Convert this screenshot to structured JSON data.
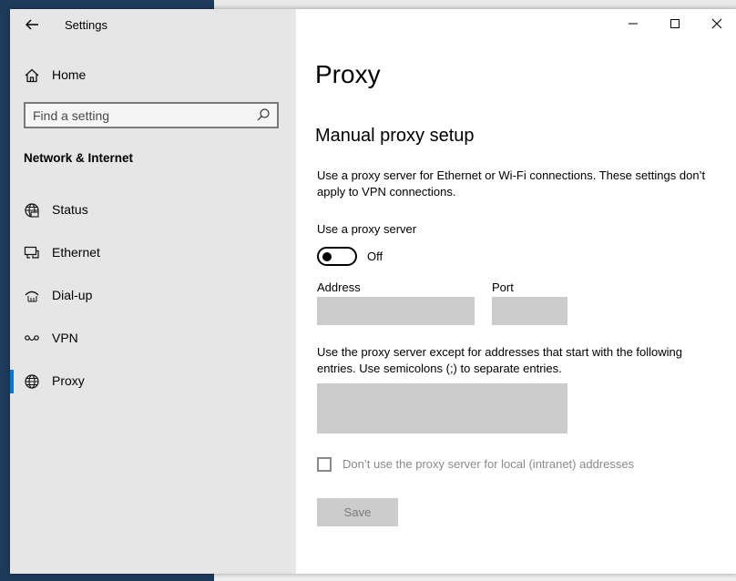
{
  "window": {
    "title": "Settings"
  },
  "sidebar": {
    "home_label": "Home",
    "search_placeholder": "Find a setting",
    "section_heading": "Network & Internet",
    "items": [
      {
        "label": "Status",
        "icon": "globe-status-icon",
        "selected": false
      },
      {
        "label": "Ethernet",
        "icon": "ethernet-icon",
        "selected": false
      },
      {
        "label": "Dial-up",
        "icon": "dial-up-icon",
        "selected": false
      },
      {
        "label": "VPN",
        "icon": "vpn-icon",
        "selected": false
      },
      {
        "label": "Proxy",
        "icon": "globe-icon",
        "selected": true
      }
    ]
  },
  "content": {
    "page_title": "Proxy",
    "section_title": "Manual proxy setup",
    "description": "Use a proxy server for Ethernet or Wi-Fi connections. These settings don’t apply to VPN connections.",
    "use_proxy_label": "Use a proxy server",
    "toggle_state": "Off",
    "address_label": "Address",
    "address_value": "",
    "port_label": "Port",
    "port_value": "",
    "exceptions_description": "Use the proxy server except for addresses that start with the following entries. Use semicolons (;) to separate entries.",
    "exceptions_value": "",
    "local_checkbox_label": "Don’t use the proxy server for local (intranet) addresses",
    "local_checkbox_checked": false,
    "save_label": "Save"
  },
  "colors": {
    "accent": "#0078d7",
    "sidebar_bg": "#e6e6e6",
    "field_bg": "#cccccc"
  }
}
